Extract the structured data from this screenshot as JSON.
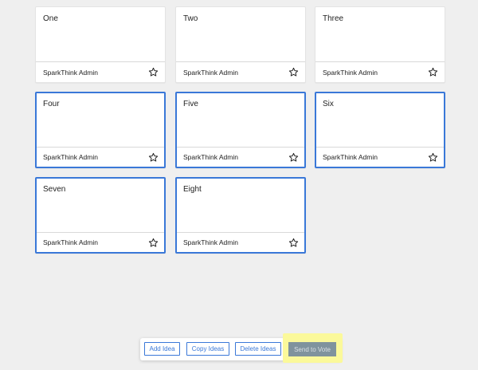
{
  "cards": [
    {
      "title": "One",
      "author": "SparkThink Admin",
      "selected": false
    },
    {
      "title": "Two",
      "author": "SparkThink Admin",
      "selected": false
    },
    {
      "title": "Three",
      "author": "SparkThink Admin",
      "selected": false
    },
    {
      "title": "Four",
      "author": "SparkThink Admin",
      "selected": true
    },
    {
      "title": "Five",
      "author": "SparkThink Admin",
      "selected": true
    },
    {
      "title": "Six",
      "author": "SparkThink Admin",
      "selected": true
    },
    {
      "title": "Seven",
      "author": "SparkThink Admin",
      "selected": true
    },
    {
      "title": "Eight",
      "author": "SparkThink Admin",
      "selected": true
    }
  ],
  "card_icon": "star-outline-icon",
  "toolbar": {
    "add_idea": "Add Idea",
    "copy_ideas": "Copy Ideas",
    "delete_ideas": "Delete Ideas",
    "send_to_vote": "Send to Vote"
  },
  "colors": {
    "background": "#efefef",
    "card": "#ffffff",
    "selected_border": "#3a78d8",
    "button_text": "#3a78d8",
    "vote_button": "#7f939d",
    "highlight": "#fbf99a"
  }
}
